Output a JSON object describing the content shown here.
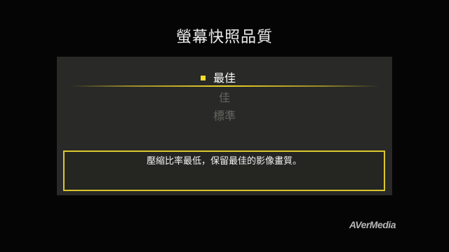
{
  "title": "螢幕快照品質",
  "options": [
    {
      "label": "最佳",
      "selected": true
    },
    {
      "label": "佳",
      "selected": false
    },
    {
      "label": "標準",
      "selected": false
    }
  ],
  "description": "壓縮比率最低，保留最佳的影像畫質。",
  "brand": "AVerMedia",
  "colors": {
    "background": "#050505",
    "panel": "#292927",
    "accent": "#ecd228",
    "dim_text": "#65655f"
  }
}
